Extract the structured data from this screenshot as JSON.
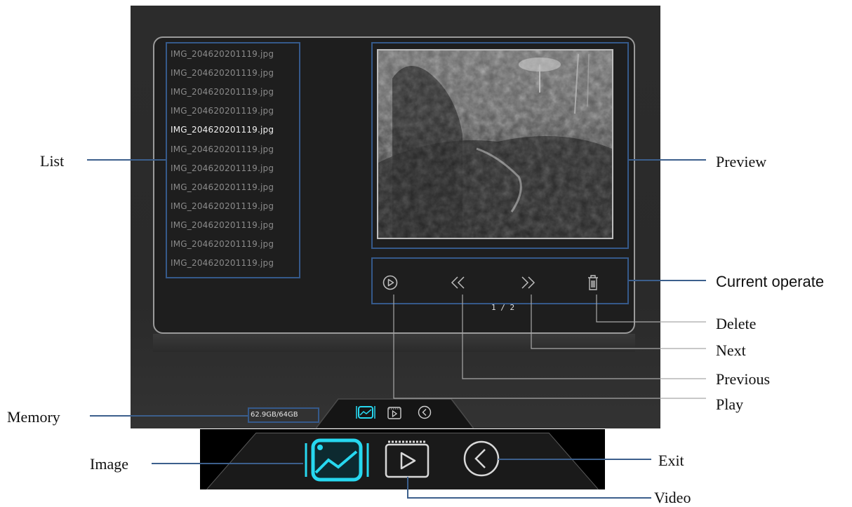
{
  "files": [
    "IMG_204620201119.jpg",
    "IMG_204620201119.jpg",
    "IMG_204620201119.jpg",
    "IMG_204620201119.jpg",
    "IMG_204620201119.jpg",
    "IMG_204620201119.jpg",
    "IMG_204620201119.jpg",
    "IMG_204620201119.jpg",
    "IMG_204620201119.jpg",
    "IMG_204620201119.jpg",
    "IMG_204620201119.jpg",
    "IMG_204620201119.jpg"
  ],
  "selected_index": 4,
  "page_indicator": "1 / 2",
  "memory": "62.9GB/64GB",
  "callouts": {
    "list": "List",
    "preview": "Preview",
    "current_operate": "Current operate",
    "delete": "Delete",
    "next": "Next",
    "previous": "Previous",
    "play": "Play",
    "memory": "Memory",
    "image": "Image",
    "exit": "Exit",
    "video": "Video"
  },
  "icons": {
    "play": "play-circle-icon",
    "previous": "double-chevron-left-icon",
    "next": "double-chevron-right-icon",
    "delete": "trash-icon",
    "image": "image-icon",
    "video": "video-icon",
    "exit": "back-circle-icon"
  },
  "colors": {
    "highlight": "#35598a",
    "callout_line": "#3c5f8c",
    "active_tab": "#27d8f0",
    "screen_bg": "#2c2c2c"
  }
}
